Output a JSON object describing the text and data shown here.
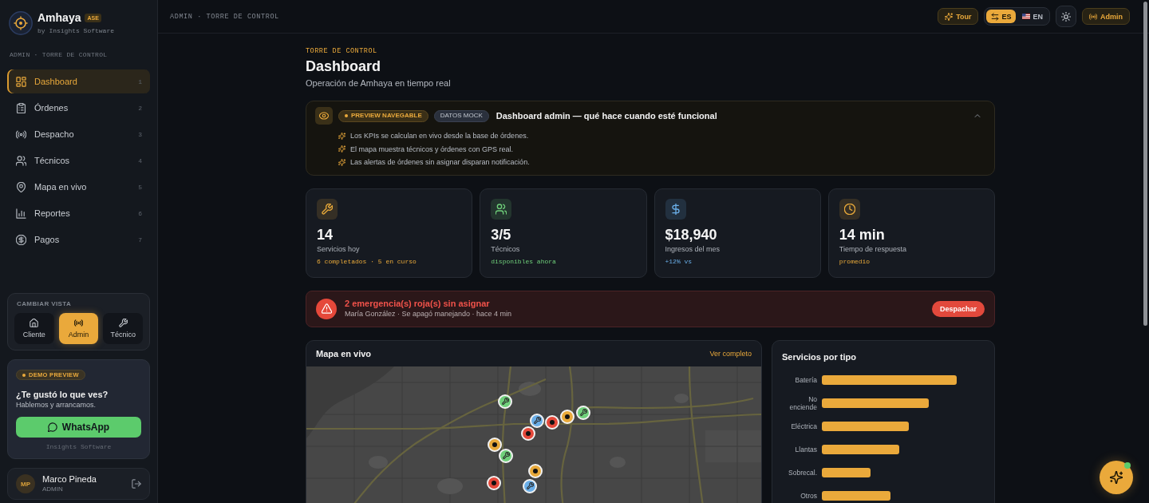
{
  "sidebar": {
    "brand": {
      "name": "Amhaya",
      "badge": "ASE",
      "byline": "by Insights Software"
    },
    "breadcrumb": "ADMIN · TORRE DE CONTROL",
    "nav": [
      {
        "label": "Dashboard",
        "shortcut": "1",
        "selected": true
      },
      {
        "label": "Órdenes",
        "shortcut": "2",
        "selected": false
      },
      {
        "label": "Despacho",
        "shortcut": "3",
        "selected": false
      },
      {
        "label": "Técnicos",
        "shortcut": "4",
        "selected": false
      },
      {
        "label": "Mapa en vivo",
        "shortcut": "5",
        "selected": false
      },
      {
        "label": "Reportes",
        "shortcut": "6",
        "selected": false
      },
      {
        "label": "Pagos",
        "shortcut": "7",
        "selected": false
      }
    ],
    "view_switcher": {
      "title": "CAMBIAR VISTA",
      "options": [
        {
          "label": "Cliente",
          "selected": false
        },
        {
          "label": "Admin",
          "selected": true
        },
        {
          "label": "Técnico",
          "selected": false
        }
      ]
    },
    "promo": {
      "badge": "DEMO PREVIEW",
      "title": "¿Te gustó lo que ves?",
      "text": "Hablemos y arrancamos.",
      "button": "WhatsApp",
      "footer": "Insights Software"
    },
    "user": {
      "initials": "MP",
      "name": "Marco Pineda",
      "role": "ADMIN"
    }
  },
  "topbar": {
    "breadcrumb": "ADMIN · TORRE DE CONTROL",
    "tour_button": "Tour",
    "languages": [
      {
        "label": "ES",
        "selected": true
      },
      {
        "label": "EN",
        "selected": false
      }
    ],
    "role_button": "Admin"
  },
  "page": {
    "eyebrow": "TORRE DE CONTROL",
    "title": "Dashboard",
    "subtitle": "Operación de Amhaya en tiempo real"
  },
  "notice": {
    "badges": [
      {
        "label": "PREVIEW NAVEGABLE",
        "kind": "status"
      },
      {
        "label": "DATOS MOCK",
        "kind": "plain"
      }
    ],
    "title": "Dashboard admin — qué hace cuando esté funcional",
    "expanded": true,
    "items": [
      "Los KPIs se calculan en vivo desde la base de órdenes.",
      "El mapa muestra técnicos y órdenes con GPS real.",
      "Las alertas de órdenes sin asignar disparan notificación."
    ]
  },
  "kpis": [
    {
      "value": "14",
      "label": "Servicios hoy",
      "note": "6 completados · 5 en curso",
      "color": "#e8a93a"
    },
    {
      "value": "3/5",
      "label": "Técnicos",
      "note": "disponibles ahora",
      "color": "#6fcf7a"
    },
    {
      "value": "$18,940",
      "label": "Ingresos del mes",
      "note": "+12% vs",
      "color": "#6aaee8"
    },
    {
      "value": "14 min",
      "label": "Tiempo de respuesta",
      "note": "promedio",
      "color": "#e8a93a"
    }
  ],
  "alert": {
    "title": "2 emergencia(s) roja(s) sin asignar",
    "text": "María González · Se apagó manejando · hace 4 min",
    "button": "Despachar"
  },
  "map": {
    "title": "Mapa en vivo",
    "link": "Ver completo",
    "markers": [
      {
        "kind": "technician",
        "color": "#6fcf7a"
      },
      {
        "kind": "technician",
        "color": "#6aaee8"
      },
      {
        "kind": "order",
        "color": "#e5483a"
      },
      {
        "kind": "order",
        "color": "#e5483a"
      },
      {
        "kind": "technician",
        "color": "#6fcf7a"
      },
      {
        "kind": "order",
        "color": "#e8a93a"
      },
      {
        "kind": "order",
        "color": "#e8a93a"
      },
      {
        "kind": "technician",
        "color": "#6fcf7a"
      },
      {
        "kind": "order",
        "color": "#e8a93a"
      },
      {
        "kind": "technician",
        "color": "#6aaee8"
      },
      {
        "kind": "order",
        "color": "#e5483a"
      }
    ]
  },
  "services_chart": {
    "title": "Servicios por tipo",
    "categories": [
      "Batería",
      "No enciende",
      "Eléctrica",
      "Llantas",
      "Sobrecal.",
      "Otros"
    ]
  },
  "assistant": {
    "online": true
  }
}
